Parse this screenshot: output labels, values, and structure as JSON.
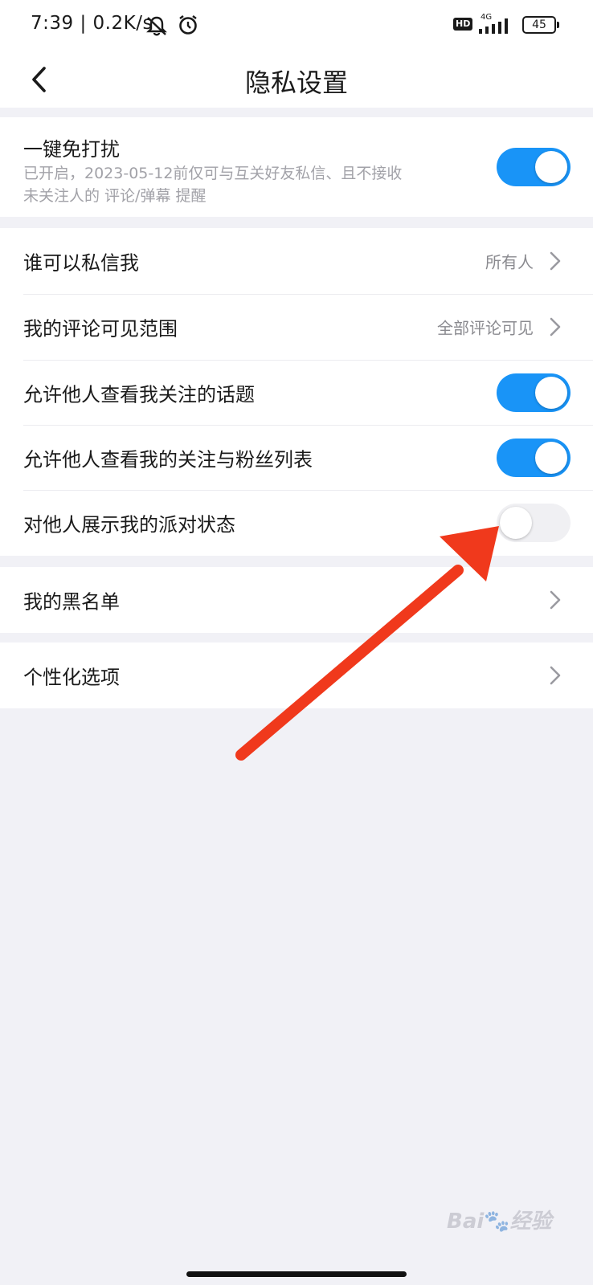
{
  "status_bar": {
    "time": "7:39",
    "speed": "| 0.2K/s",
    "hd_badge": "HD",
    "network": "4G",
    "battery": "45",
    "icons": [
      "mute-icon",
      "alarm-icon",
      "signal-icon"
    ]
  },
  "header": {
    "title": "隐私设置",
    "back_icon": "chevron-left-icon"
  },
  "dnd": {
    "title": "一键免打扰",
    "desc_line1": "已开启，2023-05-12前仅可与互关好友私信、且不接收",
    "desc_line2": "未关注人的 评论/弹幕 提醒",
    "enabled": true
  },
  "settings": {
    "who_can_message": {
      "label": "谁可以私信我",
      "value": "所有人"
    },
    "comment_visibility": {
      "label": "我的评论可见范围",
      "value": "全部评论可见"
    },
    "show_topics": {
      "label": "允许他人查看我关注的话题",
      "enabled": true
    },
    "show_follow_list": {
      "label": "允许他人查看我的关注与粉丝列表",
      "enabled": true
    },
    "show_party_status": {
      "label": "对他人展示我的派对状态",
      "enabled": false
    }
  },
  "blacklist": {
    "label": "我的黑名单"
  },
  "personalization": {
    "label": "个性化选项"
  },
  "annotation": {
    "color": "#f0391c"
  },
  "colors": {
    "accent": "#1994f7",
    "background": "#f1f1f6"
  }
}
